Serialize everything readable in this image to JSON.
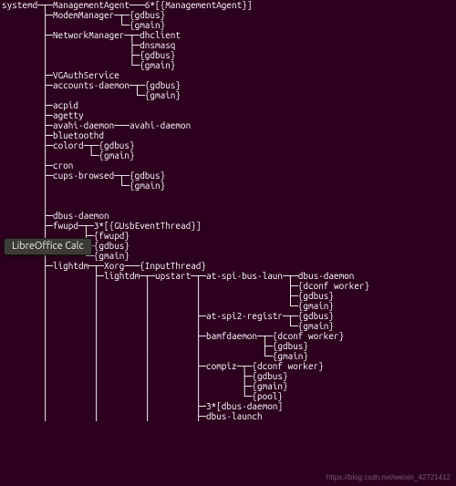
{
  "tooltip": {
    "text": "LibreOffice Calc"
  },
  "watermark": {
    "text": "https://blog.csdn.net/weixin_42721412"
  },
  "pstree": {
    "lines": [
      "systemd─┬─ManagementAgent───6*[{ManagementAgent}]",
      "        ├─ModemManager─┬─{gdbus}",
      "        │              └─{gmain}",
      "        ├─NetworkManager─┬─dhclient",
      "        │                ├─dnsmasq",
      "        │                ├─{gdbus}",
      "        │                └─{gmain}",
      "        ├─VGAuthService",
      "        ├─accounts-daemon─┬─{gdbus}",
      "        │                 └─{gmain}",
      "        ├─acpid",
      "        ├─agetty",
      "        ├─avahi-daemon───avahi-daemon",
      "        ├─bluetoothd",
      "        ├─colord─┬─{gdbus}",
      "        │        └─{gmain}",
      "        ├─cron",
      "        ├─cups-browsed─┬─{gdbus}",
      "        │              └─{gmain}",
      "        │",
      "        │",
      "        ├─dbus-daemon",
      "        ├─fwupd─┬─3*[{GUsbEventThread}]",
      "        │       ├─{fwupd}",
      "        │       ├─{gdbus}",
      "        │       └─{gmain}",
      "        ├─lightdm─┬─Xorg───{InputThread}",
      "        │         ├─lightdm─┬─upstart─┬─at-spi-bus-laun─┬─dbus-daemon",
      "        │         │         │         │                 ├─{dconf worker}",
      "        │         │         │         │                 ├─{gdbus}",
      "        │         │         │         │                 └─{gmain}",
      "        │         │         │         ├─at-spi2-registr─┬─{gdbus}",
      "        │         │         │         │                 └─{gmain}",
      "        │         │         │         ├─bamfdaemon─┬─{dconf worker}",
      "        │         │         │         │            ├─{gdbus}",
      "        │         │         │         │            └─{gmain}",
      "        │         │         │         ├─compiz─┬─{dconf worker}",
      "        │         │         │         │        ├─{gdbus}",
      "        │         │         │         │        ├─{gmain}",
      "        │         │         │         │        └─{pool}",
      "        │         │         │         ├─3*[dbus-daemon]",
      "        │         │         │         ├─dbus-launch"
    ]
  }
}
